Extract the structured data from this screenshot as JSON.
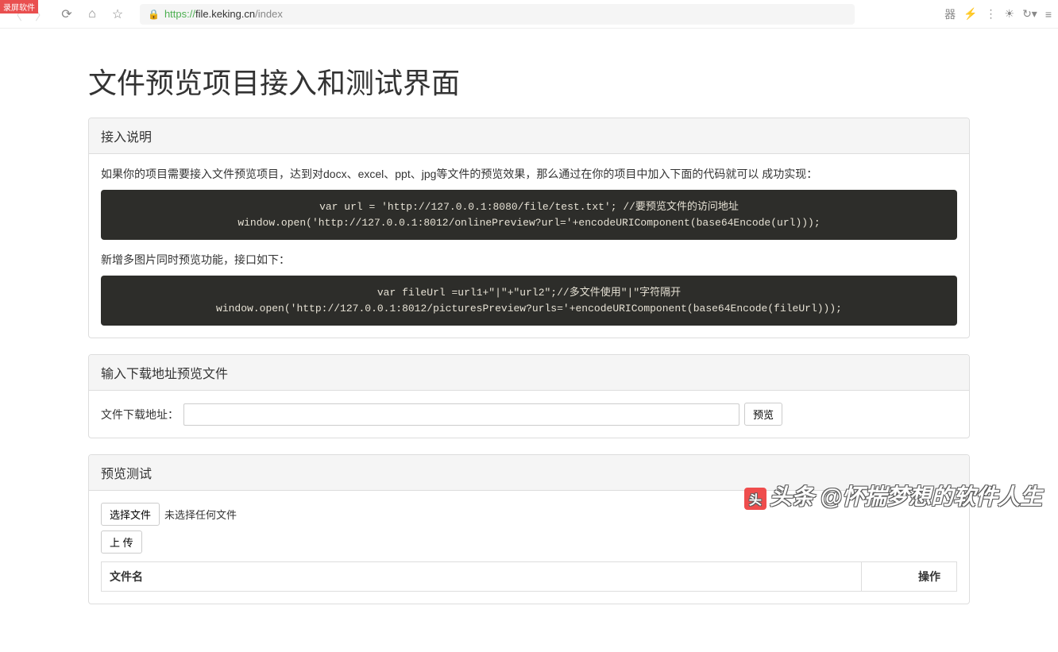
{
  "browser": {
    "corner_text": "录屏软件",
    "url_proto": "https://",
    "url_host": "file.keking.cn",
    "url_path": "/index",
    "qr_label": "器"
  },
  "page": {
    "title": "文件预览项目接入和测试界面"
  },
  "panel1": {
    "heading": "接入说明",
    "intro1": "如果你的项目需要接入文件预览项目，达到对docx、excel、ppt、jpg等文件的预览效果，那么通过在你的项目中加入下面的代码就可以 成功实现：",
    "code1": "var url = 'http://127.0.0.1:8080/file/test.txt'; //要预览文件的访问地址\nwindow.open('http://127.0.0.1:8012/onlinePreview?url='+encodeURIComponent(base64Encode(url)));",
    "intro2": "新增多图片同时预览功能，接口如下：",
    "code2": "var fileUrl =url1+\"|\"+\"url2\";//多文件使用\"|\"字符隔开\nwindow.open('http://127.0.0.1:8012/picturesPreview?urls='+encodeURIComponent(base64Encode(fileUrl)));"
  },
  "panel2": {
    "heading": "输入下载地址预览文件",
    "label": "文件下载地址：",
    "button": "预览"
  },
  "panel3": {
    "heading": "预览测试",
    "choose_file": "选择文件",
    "no_file": "未选择任何文件",
    "upload": "上 传",
    "col1": "文件名",
    "col2": "操作"
  },
  "watermark": {
    "text": "头条 @怀揣梦想的软件人生"
  }
}
